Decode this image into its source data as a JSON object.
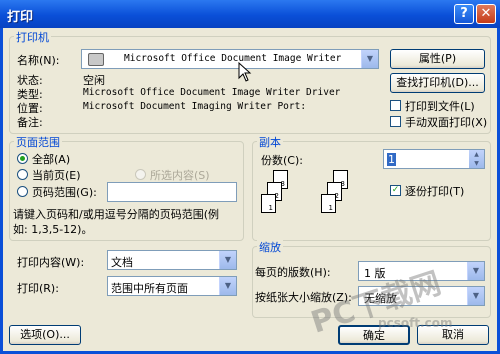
{
  "window": {
    "title": "打印",
    "help_glyph": "?",
    "close_glyph": "✕"
  },
  "printer": {
    "group_title": "打印机",
    "name_label": "名称(N):",
    "name_value": "Microsoft Office Document Image Writer",
    "properties_button": "属性(P)",
    "status_label": "状态:",
    "status_value": "空闲",
    "type_label": "类型:",
    "type_value": "Microsoft Office Document Image Writer Driver",
    "where_label": "位置:",
    "where_value": "Microsoft Document Imaging Writer Port:",
    "comment_label": "备注:",
    "find_button": "查找打印机(D)...",
    "print_to_file": "打印到文件(L)",
    "manual_duplex": "手动双面打印(X)"
  },
  "page_range": {
    "group_title": "页面范围",
    "all": "全部(A)",
    "current": "当前页(E)",
    "selection": "所选内容(S)",
    "pages": "页码范围(G):",
    "pages_value": "",
    "hint_line1": "请键入页码和/或用逗号分隔的页码范围(例",
    "hint_line2": "如: 1,3,5-12)。",
    "selected": "all"
  },
  "copies": {
    "group_title": "副本",
    "count_label": "份数(C):",
    "count_value": "1",
    "collate_label": "逐份打印(T)",
    "collate_checked": true
  },
  "print_what": {
    "label": "打印内容(W):",
    "value": "文档"
  },
  "print_range": {
    "label": "打印(R):",
    "value": "范围中所有页面"
  },
  "zoom": {
    "group_title": "缩放",
    "pages_per_sheet_label": "每页的版数(H):",
    "pages_per_sheet_value": "1 版",
    "scale_label": "按纸张大小缩放(Z):",
    "scale_value": "无缩放"
  },
  "footer": {
    "options_button": "选项(O)...",
    "ok_button": "确定",
    "cancel_button": "取消"
  },
  "watermark": {
    "text": "PC下载网",
    "url": "pcsoft.com"
  },
  "colors": {
    "title_bar": "#0a4fd8",
    "dialog_bg": "#ece9d8",
    "group_title": "#0046d5",
    "check_green": "#21a121"
  }
}
